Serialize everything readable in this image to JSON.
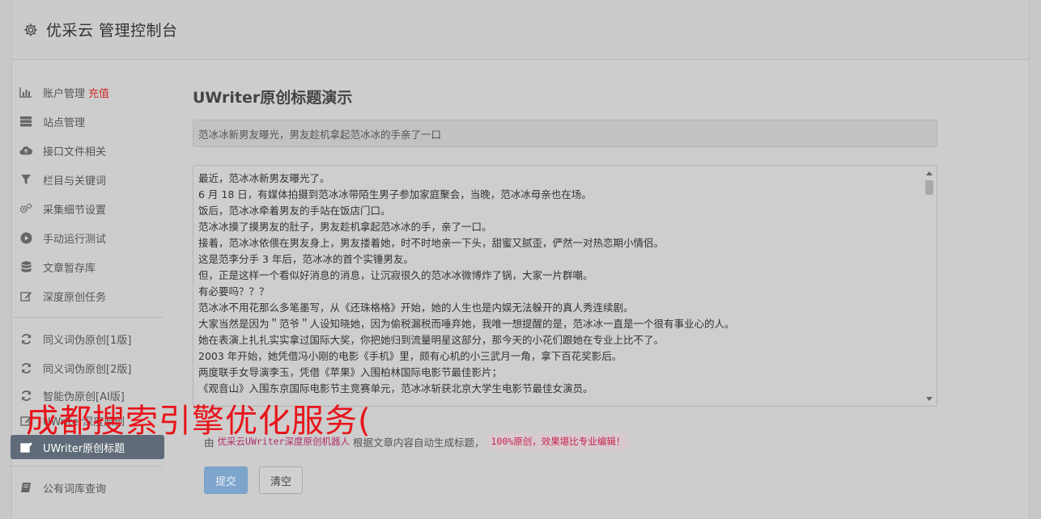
{
  "header": {
    "brand": "优采云 管理控制台"
  },
  "sidebar": {
    "items": [
      {
        "label": "账户管理",
        "badge": "充值",
        "icon": "bar-chart-icon"
      },
      {
        "label": "站点管理",
        "icon": "server-icon"
      },
      {
        "label": "接口文件相关",
        "icon": "cloud-upload-icon"
      },
      {
        "label": "栏目与关键词",
        "icon": "filter-icon"
      },
      {
        "label": "采集细节设置",
        "icon": "gears-icon"
      },
      {
        "label": "手动运行测试",
        "icon": "play-circle-icon"
      },
      {
        "label": "文章暂存库",
        "icon": "database-icon"
      },
      {
        "label": "深度原创任务",
        "icon": "edit-icon"
      }
    ],
    "group2": [
      {
        "label": "同义词伪原创[1版]",
        "icon": "refresh-icon"
      },
      {
        "label": "同义词伪原创[2版]",
        "icon": "refresh-icon"
      },
      {
        "label": "智能伪原创[AI版]",
        "icon": "refresh-icon"
      },
      {
        "label": "UWriter深度原创",
        "icon": "edit-icon"
      },
      {
        "label": "UWriter原创标题",
        "icon": "edit-icon",
        "active": true
      }
    ],
    "group3": [
      {
        "label": "公有词库查询",
        "icon": "book-icon"
      }
    ]
  },
  "main": {
    "title": "UWriter原创标题演示",
    "generated_title": "范冰冰新男友曝光，男友趁机拿起范冰冰的手亲了一口",
    "content_lines": [
      "最近，范冰冰新男友曝光了。",
      "6 月 18 日，有媒体拍摄到范冰冰带陌生男子参加家庭聚会，当晚，范冰冰母亲也在场。",
      "饭后，范冰冰牵着男友的手站在饭店门口。",
      "范冰冰摸了摸男友的肚子，男友趁机拿起范冰冰的手，亲了一口。",
      "接着，范冰冰依偎在男友身上，男友搂着她，时不时地亲一下头，甜蜜又腻歪，俨然一对热恋期小情侣。",
      "这是范李分手 3 年后，范冰冰的首个实锤男友。",
      "但，正是这样一个看似好消息的消息，让沉寂很久的范冰冰微博炸了锅，大家一片群嘲。",
      "有必要吗？？？",
      "范冰冰不用花那么多笔墨写，从《还珠格格》开始，她的人生也是内娱无法躲开的真人秀连续剧。",
      "大家当然是因为＂范爷＂人设知晓她，因为偷税漏税而唾弃她，我唯一想提醒的是，范冰冰一直是一个很有事业心的人。",
      "她在表演上扎扎实实拿过国际大奖，你把她归到流量明星这部分，那今天的小花们跟她在专业上比不了。",
      "2003 年开始，她凭借冯小刚的电影《手机》里，颇有心机的小三武月一角，拿下百花奖影后。",
      "两度联手女导演李玉，凭借《苹果》入围柏林国际电影节最佳影片；",
      "《观音山》入围东京国际电影节主竞赛单元，范冰冰斩获北京大学生电影节最佳女演员。"
    ],
    "overlay": "成都搜索引擎优化服务(",
    "desc_prefix": "由",
    "desc_brand": "优采云UWriter深度原创机器人",
    "desc_middle": "根据文章内容自动生成标题，",
    "desc_pill": "100%原创，效果堪比专业编辑！",
    "submit_label": "提交",
    "clear_label": "清空"
  }
}
